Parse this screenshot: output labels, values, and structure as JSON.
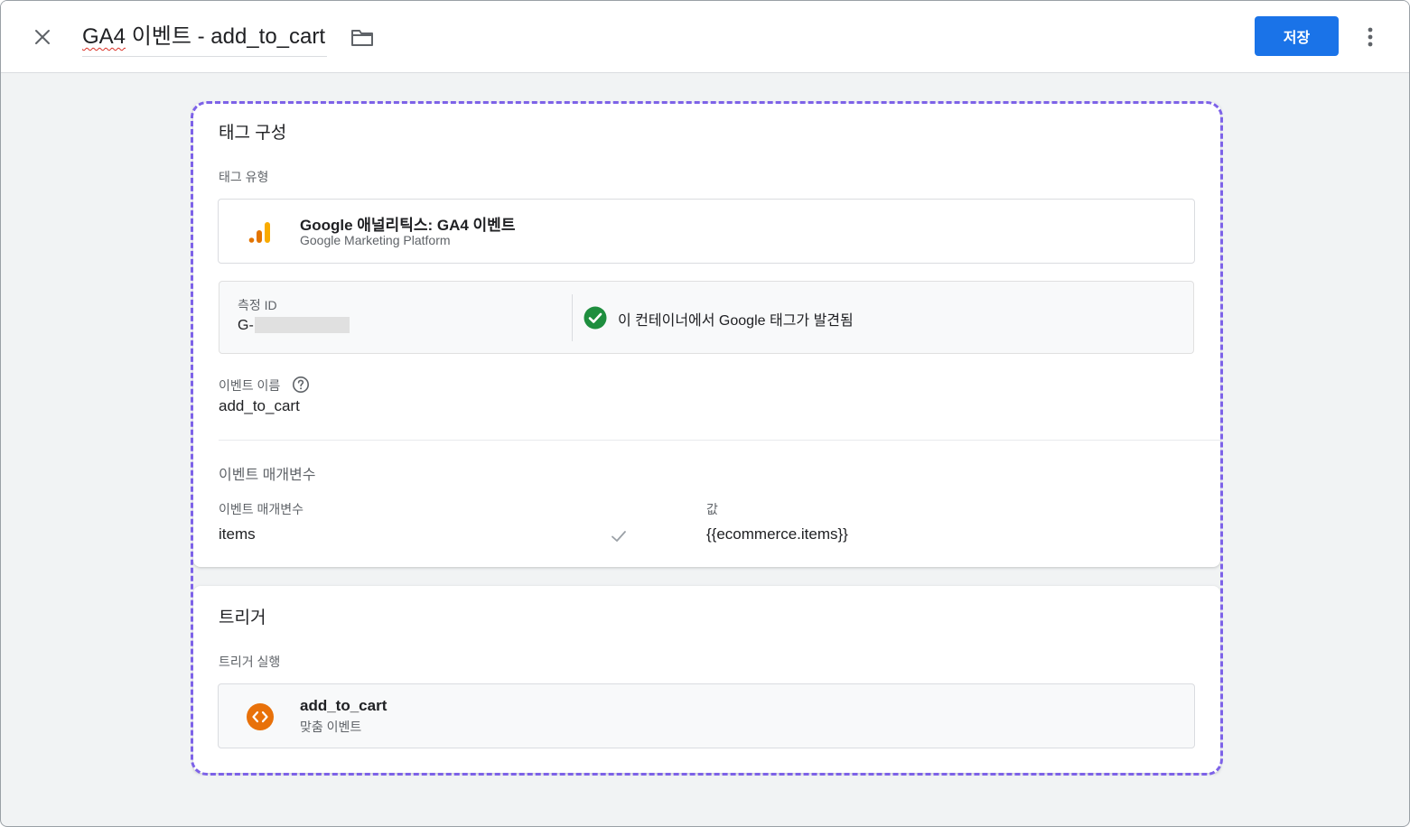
{
  "header": {
    "title_prefix": "GA4",
    "title_rest": " 이벤트 - add_to_cart",
    "save_label": "저장"
  },
  "tag_config": {
    "section_title": "태그 구성",
    "tag_type_label": "태그 유형",
    "tag_type": {
      "name": "Google 애널리틱스: GA4 이벤트",
      "platform": "Google Marketing Platform",
      "icon": "analytics-bars-icon"
    },
    "measurement": {
      "label": "측정 ID",
      "value_prefix": "G-",
      "status_text": "이 컨테이너에서 Google 태그가 발견됨",
      "status_color": "#1e8e3e"
    },
    "event_name_label": "이벤트 이름",
    "event_name_value": "add_to_cart",
    "params": {
      "section_title": "이벤트 매개변수",
      "col_param": "이벤트 매개변수",
      "col_value": "값",
      "rows": [
        {
          "param": "items",
          "value": "{{ecommerce.items}}"
        }
      ]
    }
  },
  "trigger": {
    "section_title": "트리거",
    "firing_label": "트리거 실행",
    "item": {
      "name": "add_to_cart",
      "type": "맞춤 이벤트",
      "icon": "code-brackets-icon",
      "icon_color": "#e8710a"
    }
  },
  "colors": {
    "accent": "#1a73e8",
    "highlight_dash": "#7d62e8"
  }
}
